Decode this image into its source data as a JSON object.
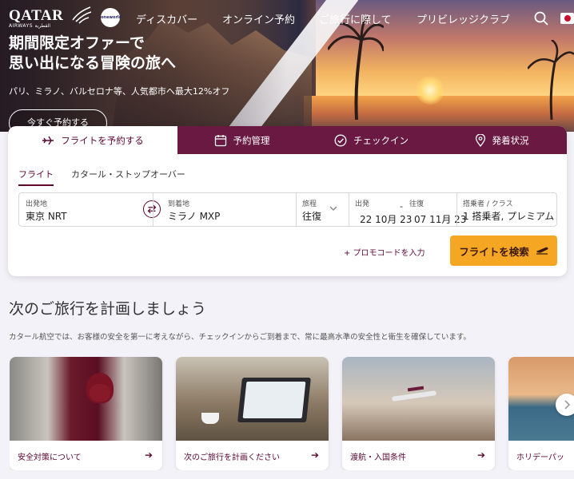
{
  "brand": {
    "name": "QATAR",
    "sub": "AIRWAYS القطرية",
    "alliance": "oneworld"
  },
  "nav": {
    "items": [
      "ディスカバー",
      "オンライン予約",
      "ご旅行に際して",
      "プリビレッジクラブ"
    ]
  },
  "hero": {
    "title": "期間限定オファーで\n思い出になる冒険の旅へ",
    "subtitle": "パリ、ミラノ、バルセロナ等、人気都市へ最大12%オフ",
    "cta": "今すぐ予約する"
  },
  "booking": {
    "tabs": [
      "フライトを予約する",
      "予約管理",
      "チェックイン",
      "発着状況"
    ],
    "subtabs": [
      "フライト",
      "カタール・ストップオーバー"
    ],
    "fields": {
      "origin": {
        "label": "出発地",
        "value": "東京 NRT"
      },
      "destination": {
        "label": "到着地",
        "value": "ミラノ MXP"
      },
      "trip": {
        "label": "旅程",
        "value": "往復"
      },
      "depart": {
        "label": "出発",
        "value": "22 10月 23"
      },
      "dash": "-",
      "return": {
        "label": "往復",
        "value": "07 11月 23"
      },
      "pax": {
        "label": "搭乗者 / クラス",
        "value": "1 搭乗者, プレミアム"
      }
    },
    "promo": "+ プロモコードを入力",
    "search": "フライトを検索"
  },
  "section": {
    "title": "次のご旅行を計画しましょう",
    "description": "カタール航空では、お客様の安全を第一に考えながら、チェックインからご到着まで、常に最高水準の安全性と衛生を確保しています。"
  },
  "tiles": [
    {
      "caption": "安全対策について"
    },
    {
      "caption": "次のご旅行を計画ください"
    },
    {
      "caption": "渡航・入国条件"
    },
    {
      "caption": "ホリデーパッ"
    }
  ],
  "colors": {
    "brand": "#5c0632",
    "tabbar": "#6a1a42",
    "accent": "#f5a623"
  }
}
